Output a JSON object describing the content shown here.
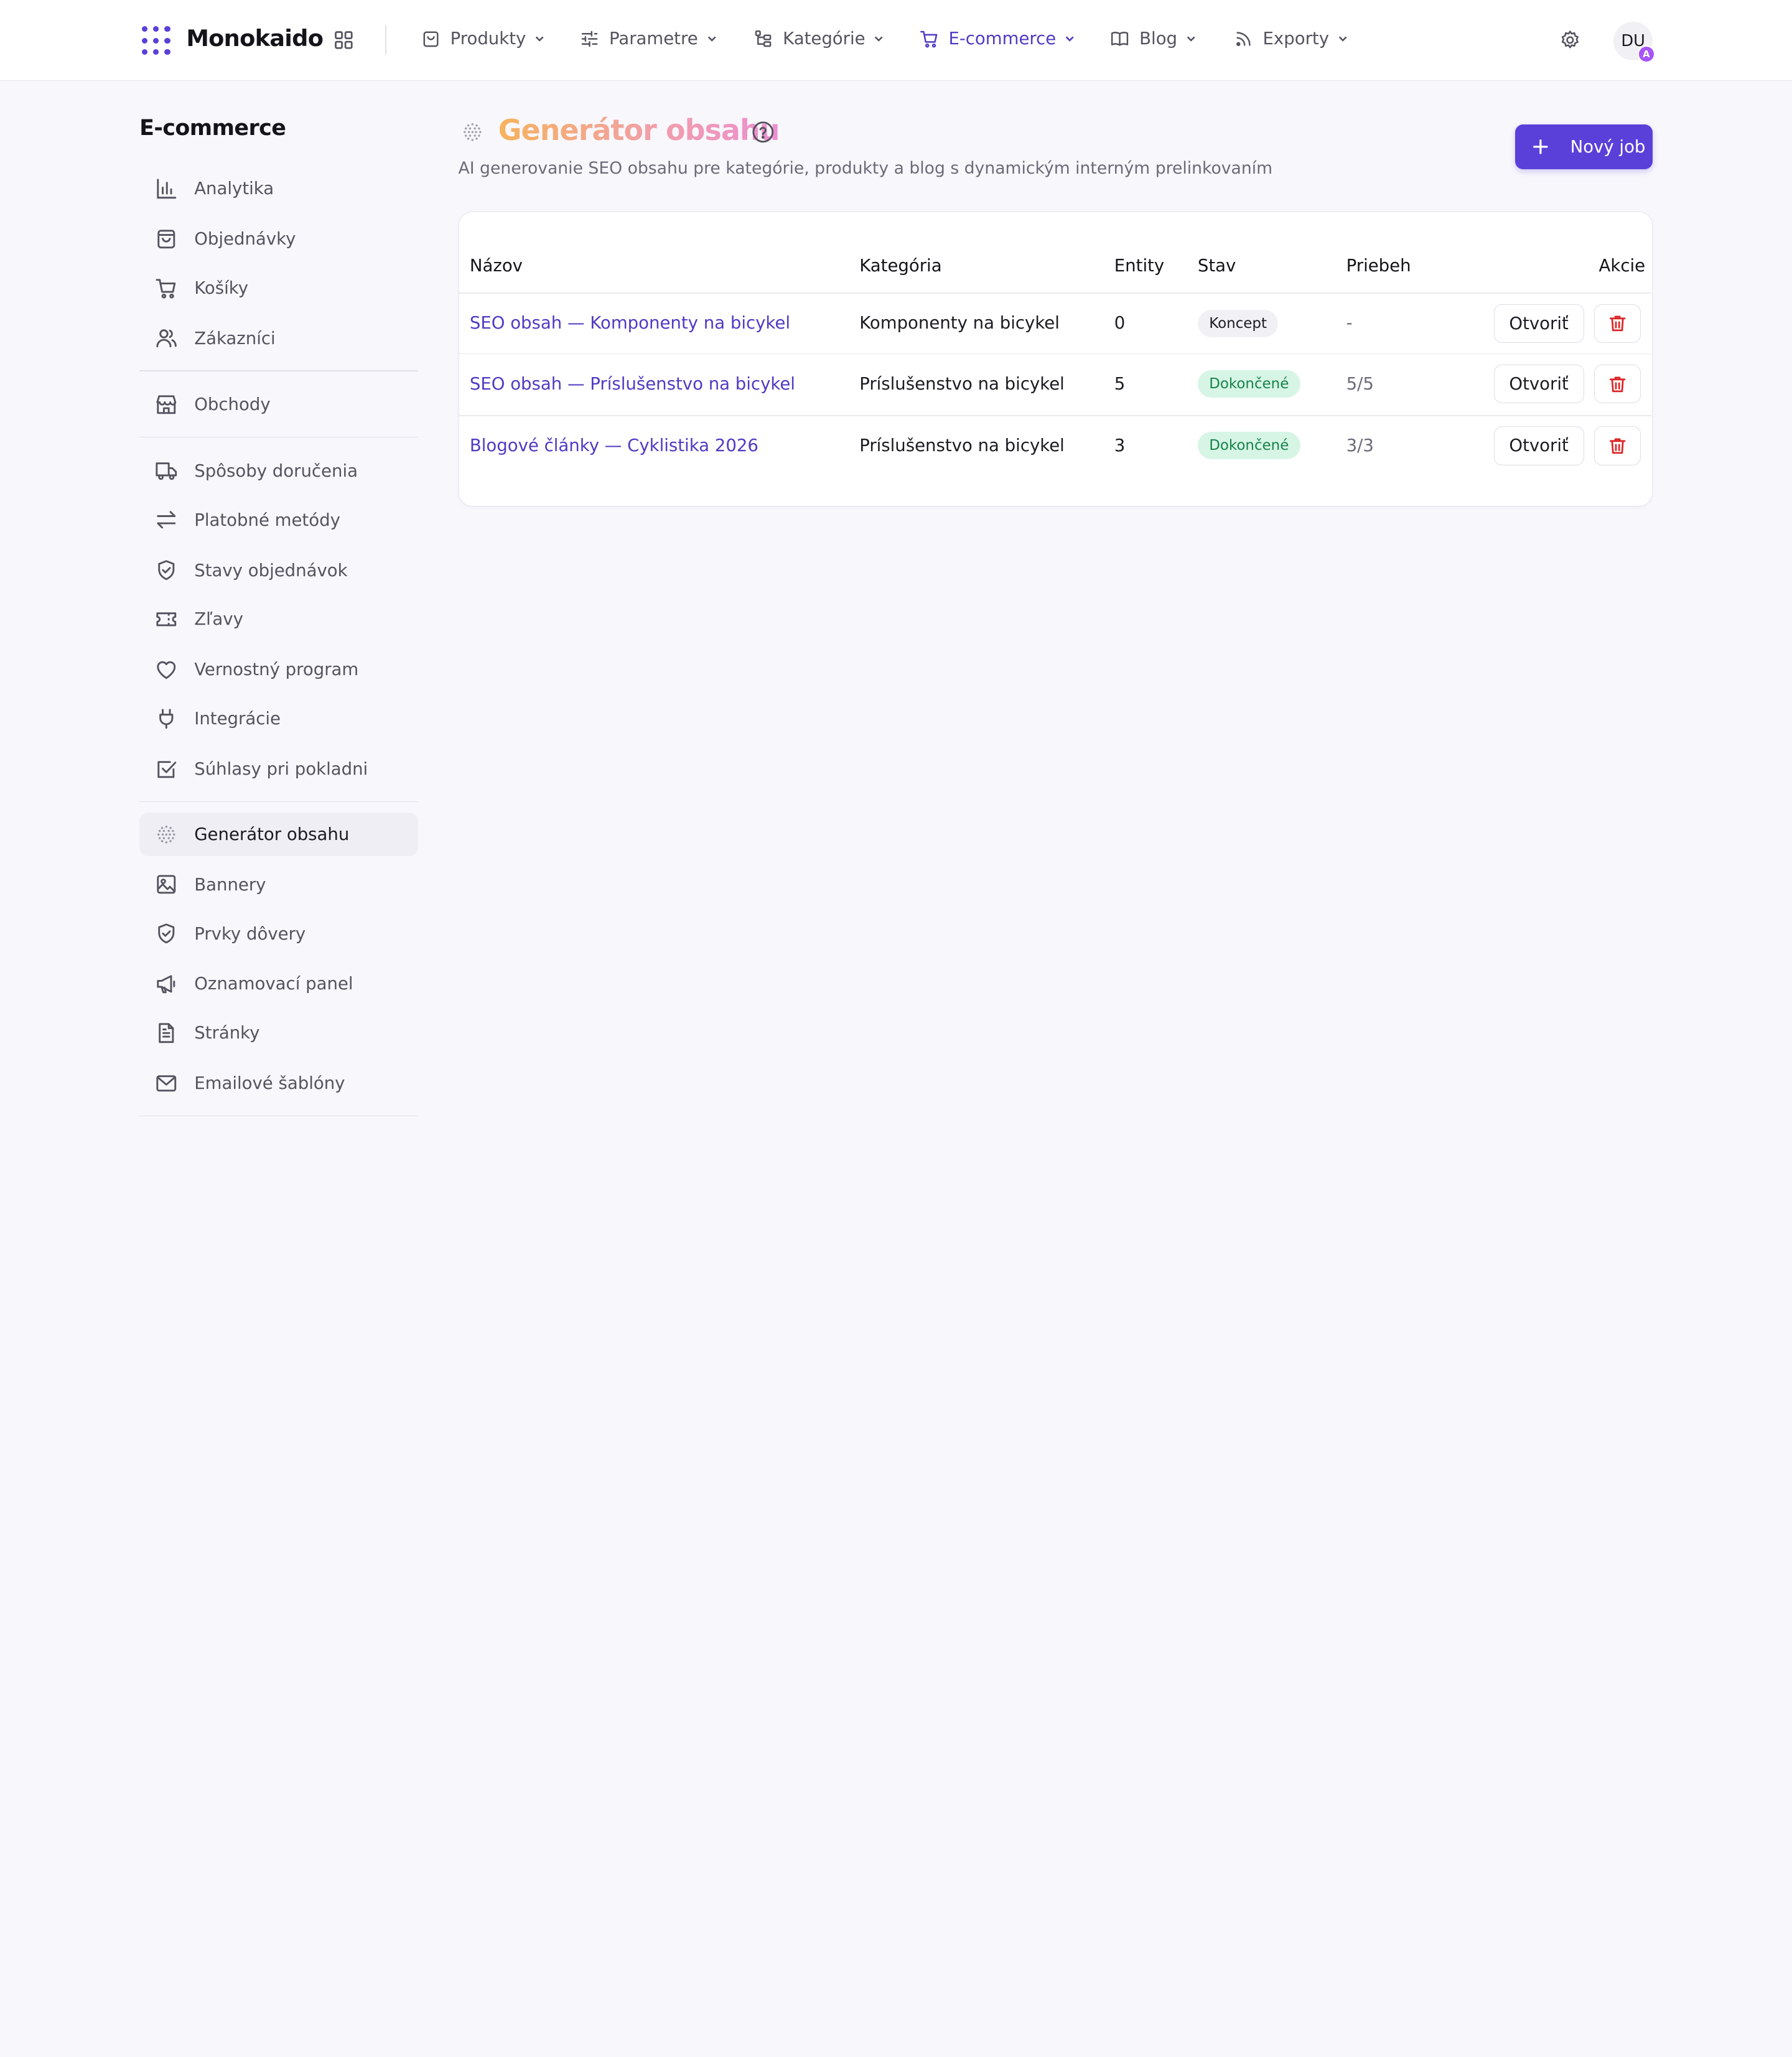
{
  "brand": "Monokaido",
  "nav": [
    {
      "label": "Produkty",
      "icon": "shopping-bag-icon"
    },
    {
      "label": "Parametre",
      "icon": "sliders-icon"
    },
    {
      "label": "Kategórie",
      "icon": "category-tree-icon"
    },
    {
      "label": "E-commerce",
      "icon": "cart-icon",
      "active": true
    },
    {
      "label": "Blog",
      "icon": "book-open-icon"
    },
    {
      "label": "Exporty",
      "icon": "rss-icon"
    }
  ],
  "user": {
    "initials": "DU",
    "badge": "A"
  },
  "sidebar": {
    "title": "E-commerce",
    "items": [
      {
        "label": "Analytika",
        "icon": "bar-chart-icon"
      },
      {
        "label": "Objednávky",
        "icon": "shopping-bag-icon"
      },
      {
        "label": "Košíky",
        "icon": "cart-icon"
      },
      {
        "label": "Zákazníci",
        "icon": "users-icon"
      },
      {
        "label": "Obchody",
        "icon": "store-icon"
      },
      {
        "label": "Spôsoby doručenia",
        "icon": "truck-icon"
      },
      {
        "label": "Platobné metódy",
        "icon": "arrows-swap-icon"
      },
      {
        "label": "Stavy objednávok",
        "icon": "shield-check-icon"
      },
      {
        "label": "Zľavy",
        "icon": "ticket-icon"
      },
      {
        "label": "Vernostný program",
        "icon": "heart-icon"
      },
      {
        "label": "Integrácie",
        "icon": "plug-icon"
      },
      {
        "label": "Súhlasy pri pokladni",
        "icon": "checkbox-icon"
      },
      {
        "label": "Generátor obsahu",
        "icon": "sparkle-globe-icon",
        "active": true
      },
      {
        "label": "Bannery",
        "icon": "image-icon"
      },
      {
        "label": "Prvky dôvery",
        "icon": "shield-check-icon"
      },
      {
        "label": "Oznamovací panel",
        "icon": "megaphone-icon"
      },
      {
        "label": "Stránky",
        "icon": "file-text-icon"
      },
      {
        "label": "Emailové šablóny",
        "icon": "mail-icon"
      }
    ]
  },
  "page": {
    "title": "Generátor obsahu",
    "subtitle": "AI generovanie SEO obsahu pre kategórie, produkty a blog s dynamickým interným prelinkovaním",
    "new_button": "Nový job"
  },
  "table": {
    "headers": [
      "Názov",
      "Kategória",
      "Entity",
      "Stav",
      "Priebeh",
      "Akcie"
    ],
    "rows": [
      {
        "name": "SEO obsah — Komponenty na bicykel",
        "category": "Komponenty na bicykel",
        "entities": "0",
        "status": "Koncept",
        "status_type": "draft",
        "progress": "-",
        "open": "Otvoriť"
      },
      {
        "name": "SEO obsah — Príslušenstvo na bicykel",
        "category": "Príslušenstvo na bicykel",
        "entities": "5",
        "status": "Dokončené",
        "status_type": "done",
        "progress": "5/5",
        "open": "Otvoriť"
      },
      {
        "name": "Blogové články — Cyklistika 2026",
        "category": "Príslušenstvo na bicykel",
        "entities": "3",
        "status": "Dokončené",
        "status_type": "done",
        "progress": "3/3",
        "open": "Otvoriť"
      }
    ]
  },
  "colors": {
    "accent": "#5b3fd9",
    "link": "#4f3bc4",
    "success_bg": "#d7f5e5",
    "success_text": "#17834b",
    "danger": "#dc2626"
  }
}
